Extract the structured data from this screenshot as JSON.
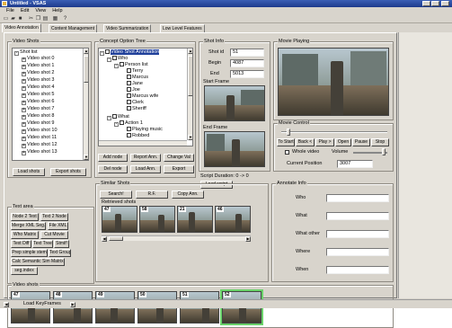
{
  "app": {
    "title": "Untitled - VSAS",
    "menu": [
      "File",
      "Edit",
      "View",
      "Help"
    ],
    "toolbar_icons": [
      "new-icon",
      "open-icon",
      "save-icon",
      "cut-icon",
      "copy-icon",
      "paste-icon",
      "print-icon",
      "help-icon"
    ]
  },
  "tabs": [
    {
      "label": "Video Annotation"
    },
    {
      "label": "Content Management"
    },
    {
      "label": "Video Summarization"
    },
    {
      "label": "Low Level Features"
    }
  ],
  "video_shots": {
    "title": "Video Shots",
    "root": "Shot list",
    "items": [
      "Video shot 0",
      "Video shot 1",
      "Video shot 2",
      "Video shot 3",
      "Video shot 4",
      "Video shot 5",
      "Video shot 6",
      "Video shot 7",
      "Video shot 8",
      "Video shot 9",
      "Video shot 10",
      "Video shot 11",
      "Video shot 12",
      "Video shot 13"
    ],
    "load_label": "Load shots",
    "export_label": "Export shots"
  },
  "concept_tree": {
    "title": "Concept Option Tree",
    "root": "Video Shot Annotation",
    "nodes": [
      "Who",
      "Person list",
      "Terry",
      "Marcus",
      "Jane",
      "Joe",
      "Marcus wife",
      "Clerk",
      "Sheriff",
      "What",
      "Action 1",
      "Playing music",
      "Robbed"
    ],
    "buttons": {
      "add_node": "Add node",
      "report_ann": "Report Ann.",
      "change_val": "Change Val",
      "del_node": "Del node",
      "load_ann": "Load Ann.",
      "export": "Export"
    }
  },
  "shot_info": {
    "title": "Shot Info",
    "shot_id_label": "Shot id",
    "shot_id": "51",
    "begin_label": "Begin",
    "begin": "4087",
    "end_label": "End",
    "end": "5013",
    "start_frame_label": "Start Frame",
    "end_frame_label": "End Frame",
    "script_duration": "Script Duration: 0 -> 0",
    "load_script": "Load script"
  },
  "movie": {
    "title": "Movie Playing",
    "control_title": "Movie Control",
    "buttons": [
      "To Start",
      "Back <",
      "Play >",
      "Open",
      "Pause",
      "Stop"
    ],
    "whole_video_label": "Whole video",
    "volume_label": "Volume",
    "current_position_label": "Current Position",
    "current_position": "3007"
  },
  "text_area": {
    "title": "Text area",
    "buttons": [
      "Node 2 Text",
      "Text 2 Node",
      "Merge XML Seg.",
      "File XML",
      "Who Matrix",
      "Cut Movie",
      "Text Diff",
      "Text Tree",
      "Stmif!",
      "Prep simple stem",
      "Text Group",
      "Calc Semantic Sim Matrix",
      "seg.index"
    ]
  },
  "similar_shots": {
    "title": "Similar Shots",
    "buttons": [
      "Search!",
      "R.F.",
      "Copy Ann."
    ],
    "retrieved_label": "Retrieved shots",
    "retrieved": [
      "47",
      "58",
      "21",
      "46"
    ]
  },
  "annotate_info": {
    "title": "Annotate Info",
    "fields": [
      "Who",
      "What",
      "What other",
      "Where",
      "When"
    ]
  },
  "video_shots_strip": {
    "title": "Video shots",
    "frames": [
      "47",
      "48",
      "49",
      "50",
      "51",
      "52"
    ],
    "load_key_label": "Load KeyFrames"
  }
}
